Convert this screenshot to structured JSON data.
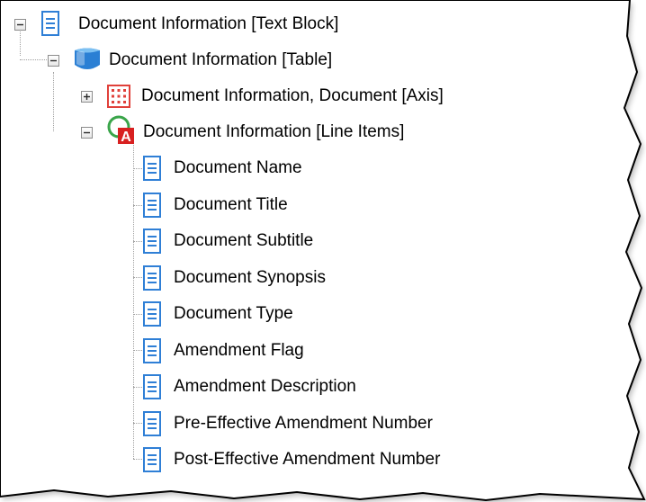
{
  "tree": {
    "root": {
      "label": "Document Information [Text Block]",
      "icon": "text-block-icon",
      "expanded": true
    },
    "table": {
      "label": "Document Information [Table]",
      "icon": "table-icon",
      "expanded": true
    },
    "axis": {
      "label": "Document Information, Document [Axis]",
      "icon": "axis-icon",
      "expanded": false
    },
    "line_items": {
      "label": "Document Information [Line Items]",
      "icon": "line-items-icon",
      "expanded": true
    },
    "items": [
      {
        "label": "Document Name",
        "icon": "concept-icon"
      },
      {
        "label": "Document Title",
        "icon": "concept-icon"
      },
      {
        "label": "Document Subtitle",
        "icon": "concept-icon"
      },
      {
        "label": "Document Synopsis",
        "icon": "concept-icon"
      },
      {
        "label": "Document Type",
        "icon": "concept-icon"
      },
      {
        "label": "Amendment Flag",
        "icon": "concept-icon"
      },
      {
        "label": "Amendment Description",
        "icon": "concept-icon"
      },
      {
        "label": "Pre-Effective Amendment Number",
        "icon": "concept-icon"
      },
      {
        "label": "Post-Effective Amendment Number",
        "icon": "concept-icon"
      }
    ]
  },
  "colors": {
    "frame_border": "#000000",
    "page_icon_blue": "#2f7fd6",
    "table_icon_blue": "#2a7fd4",
    "axis_icon_red": "#e0403a",
    "line_items_green": "#3aa54a",
    "line_items_red": "#d82020"
  }
}
